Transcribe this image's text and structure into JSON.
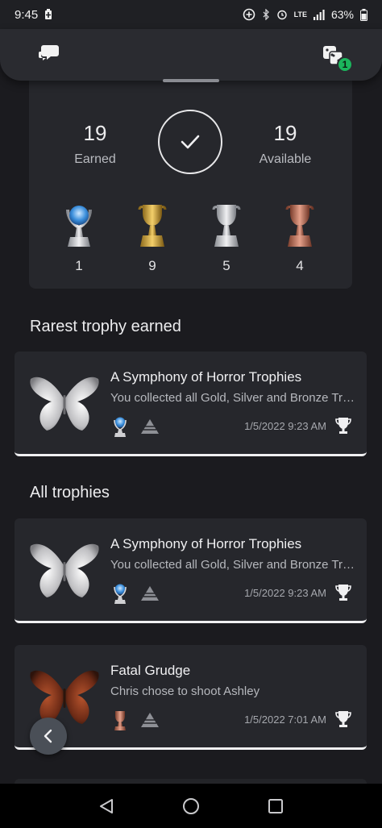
{
  "status_bar": {
    "time": "9:45",
    "network": "LTE",
    "battery": "63%"
  },
  "topbar": {
    "badge_count": "1"
  },
  "summary": {
    "earned_count": "19",
    "earned_label": "Earned",
    "available_count": "19",
    "available_label": "Available",
    "trophies": {
      "platinum": "1",
      "gold": "9",
      "silver": "5",
      "bronze": "4"
    }
  },
  "sections": {
    "rarest": "Rarest trophy earned",
    "all": "All trophies"
  },
  "cards": [
    {
      "title": "A Symphony of Horror Trophies",
      "description": "You collected all Gold, Silver and Bronze Trophies",
      "date": "1/5/2022  9:23 AM",
      "grade": "platinum"
    },
    {
      "title": "A Symphony of Horror Trophies",
      "description": "You collected all Gold, Silver and Bronze Trophies",
      "date": "1/5/2022  9:23 AM",
      "grade": "platinum"
    },
    {
      "title": "Fatal Grudge",
      "description": "Chris chose to shoot Ashley",
      "date": "1/5/2022  7:01 AM",
      "grade": "bronze"
    }
  ],
  "colors": {
    "background": "#1b1b1f",
    "card": "#26272c",
    "badge": "#1bb55c",
    "fab": "#4a4f57"
  },
  "icons": {
    "topbar_left": "chat-bubbles-icon",
    "topbar_right": "game-controller-icon",
    "fab": "chevron-left-icon",
    "nav_back": "triangle-back-icon",
    "nav_home": "circle-home-icon",
    "nav_recents": "square-recents-icon"
  }
}
